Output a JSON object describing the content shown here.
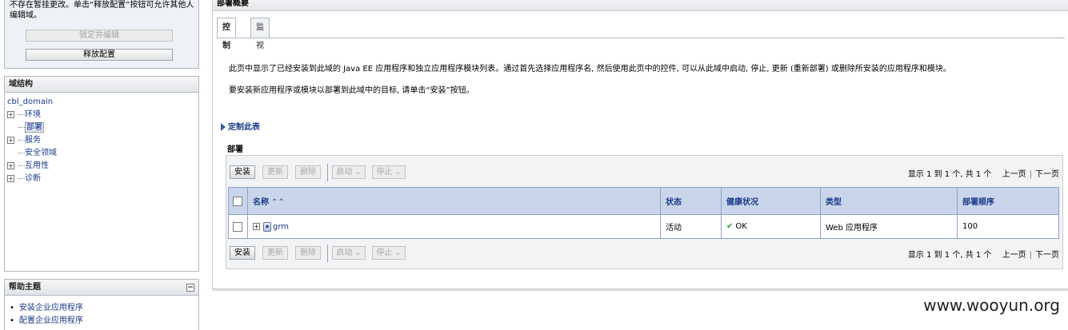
{
  "left": {
    "lock_notice": "不存在暂挂更改。单击“释放配置”按钮可允许其他人编辑域。",
    "lock_button": "锁定并编辑",
    "release_button": "释放配置",
    "structure_title": "域结构",
    "tree": {
      "root": "cbl_domain",
      "items": [
        "环境",
        "部署",
        "服务",
        "安全领域",
        "互用性",
        "诊断"
      ]
    },
    "help_title": "帮助主题",
    "help_items": [
      "安装企业应用程序",
      "配置企业应用程序"
    ]
  },
  "main": {
    "title": "部署概要",
    "tabs": [
      "控制",
      "监视"
    ],
    "intro_line1": "此页中显示了已经安装到此域的 Java EE 应用程序和独立应用程序模块列表。通过首先选择应用程序名, 然后使用此页中的控件, 可以从此域中启动, 停止, 更新 (重新部署) 或删除所安装的应用程序和模块。",
    "intro_line2": "要安装新应用程序或模块以部署到此域中的目标, 请单击“安装”按钮。",
    "customize_link": "定制此表",
    "section_label": "部署",
    "toolbar": {
      "install": "安装",
      "update": "更新",
      "delete": "删除",
      "start": "启动",
      "stop": "停止"
    },
    "pager": {
      "summary": "显示 1 到 1 个, 共 1 个",
      "prev": "上一页",
      "next": "下一页"
    },
    "table": {
      "headers": [
        "名称",
        "状态",
        "健康状况",
        "类型",
        "部署顺序"
      ],
      "rows": [
        {
          "name": "grm",
          "state": "活动",
          "health": "OK",
          "type": "Web 应用程序",
          "order": "100"
        }
      ]
    }
  },
  "watermark": "www.wooyun.org"
}
